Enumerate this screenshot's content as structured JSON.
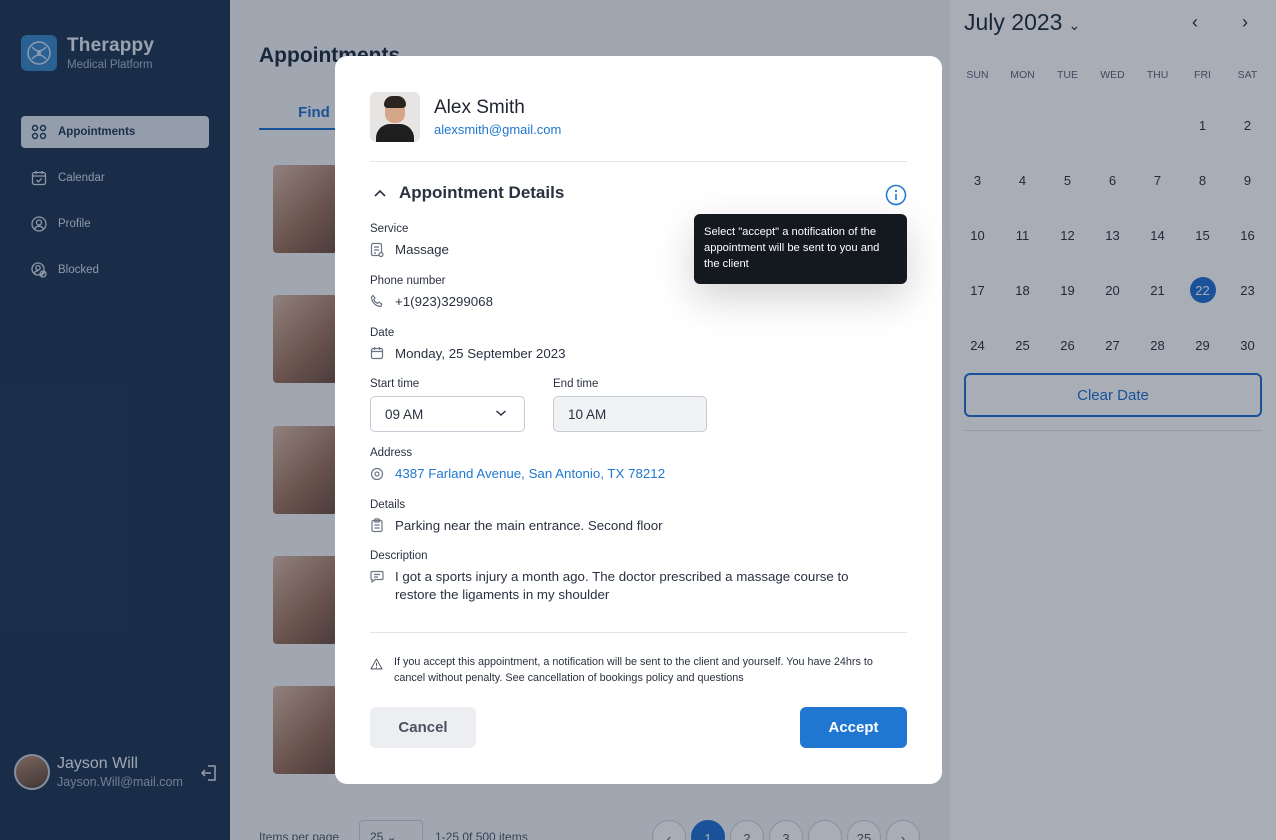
{
  "app": {
    "name": "Therappy",
    "subtitle": "Medical Platform"
  },
  "sidebar": {
    "items": [
      {
        "label": "Appointments",
        "icon": "grid-icon",
        "active": true
      },
      {
        "label": "Calendar",
        "icon": "calendar-icon",
        "active": false
      },
      {
        "label": "Profile",
        "icon": "user-circle-icon",
        "active": false
      },
      {
        "label": "Blocked",
        "icon": "blocked-user-icon",
        "active": false
      }
    ],
    "user": {
      "name": "Jayson Will",
      "email": "Jayson.Will@mail.com"
    }
  },
  "main": {
    "title": "Appointments",
    "tab_find": "Find",
    "pager": {
      "items_per_page_label": "Items per page",
      "items_per_page_value": "25",
      "range": "1-25 0f 500 items",
      "pages": [
        "1",
        "2",
        "3",
        "...",
        "25"
      ],
      "prev": "‹",
      "next": "›"
    }
  },
  "calendar": {
    "month_label": "July 2023",
    "month_chevron": "⌄",
    "prev": "‹",
    "next": "›",
    "weekdays": [
      "SUN",
      "MON",
      "TUE",
      "WED",
      "THU",
      "FRI",
      "SAT"
    ],
    "weeks": [
      [
        "",
        "",
        "",
        "",
        "",
        "1",
        "2"
      ],
      [
        "3",
        "4",
        "5",
        "6",
        "7",
        "8",
        "9"
      ],
      [
        "10",
        "11",
        "12",
        "13",
        "14",
        "15",
        "16"
      ],
      [
        "17",
        "18",
        "19",
        "20",
        "21",
        "22",
        "23"
      ],
      [
        "24",
        "25",
        "26",
        "27",
        "28",
        "29",
        "30"
      ]
    ],
    "selected_day": "22",
    "clear_label": "Clear Date"
  },
  "modal": {
    "client_name": "Alex Smith",
    "client_email": "alexsmith@gmail.com",
    "section_title": "Appointment Details",
    "tooltip": "Select \"accept\" a notification of the appointment will be sent to you and the client",
    "service_label": "Service",
    "service_value": "Massage",
    "phone_label": "Phone number",
    "phone_value": "+1(923)3299068",
    "date_label": "Date",
    "date_value": "Monday, 25 September 2023",
    "start_label": "Start time",
    "start_value": "09 AM",
    "end_label": "End time",
    "end_value": "10 AM",
    "address_label": "Address",
    "address_value": "4387 Farland Avenue, San Antonio, TX 78212",
    "details_label": "Details",
    "details_value": "Parking near the main entrance. Second floor",
    "description_label": "Description",
    "description_value": "I got a sports injury a month ago. The doctor prescribed a massage course to restore the ligaments in my shoulder",
    "notice": "If you accept this appointment, a notification will be sent to the client and yourself.  You have 24hrs to cancel without penalty. See cancellation of bookings policy and questions",
    "cancel_label": "Cancel",
    "accept_label": "Accept"
  },
  "colors": {
    "sidebar_bg": "#1f3655",
    "accent": "#1f77d1",
    "tooltip_bg": "#14181f"
  }
}
